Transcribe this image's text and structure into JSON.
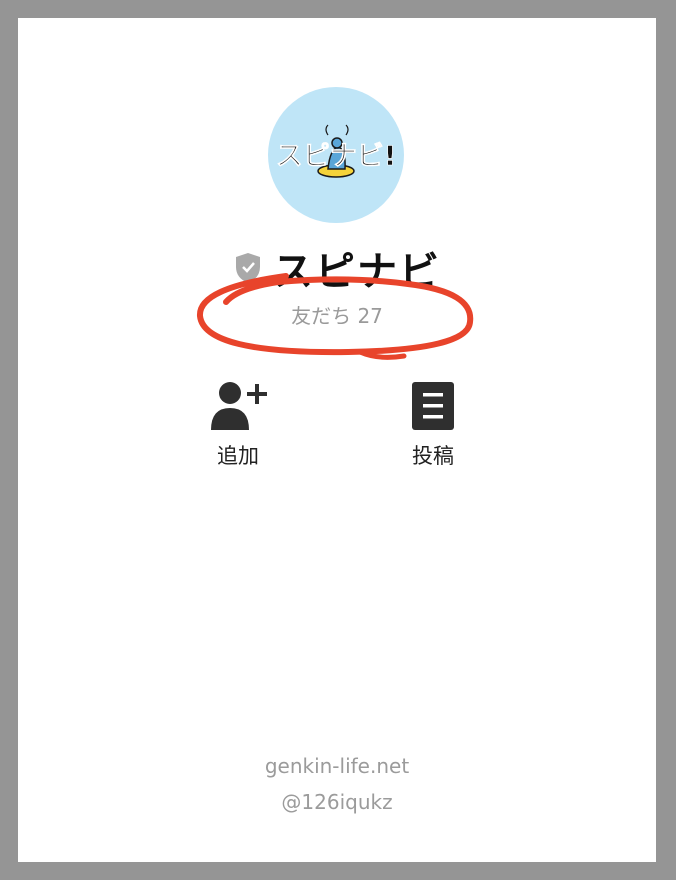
{
  "profile": {
    "logo_text": "スピナビ!",
    "account_name": "スピナビ",
    "friends_label": "友だち 27"
  },
  "actions": {
    "add_label": "追加",
    "post_label": "投稿"
  },
  "footer": {
    "site": "genkin-life.net",
    "handle": "@126iqukz"
  },
  "icons": {
    "verified": "shield-icon",
    "add": "add-friend-icon",
    "post": "post-icon"
  },
  "colors": {
    "frame": "#959595",
    "avatar_bg": "#bfe5f7",
    "annotation": "#e8442b",
    "icon": "#2f2f2f"
  }
}
